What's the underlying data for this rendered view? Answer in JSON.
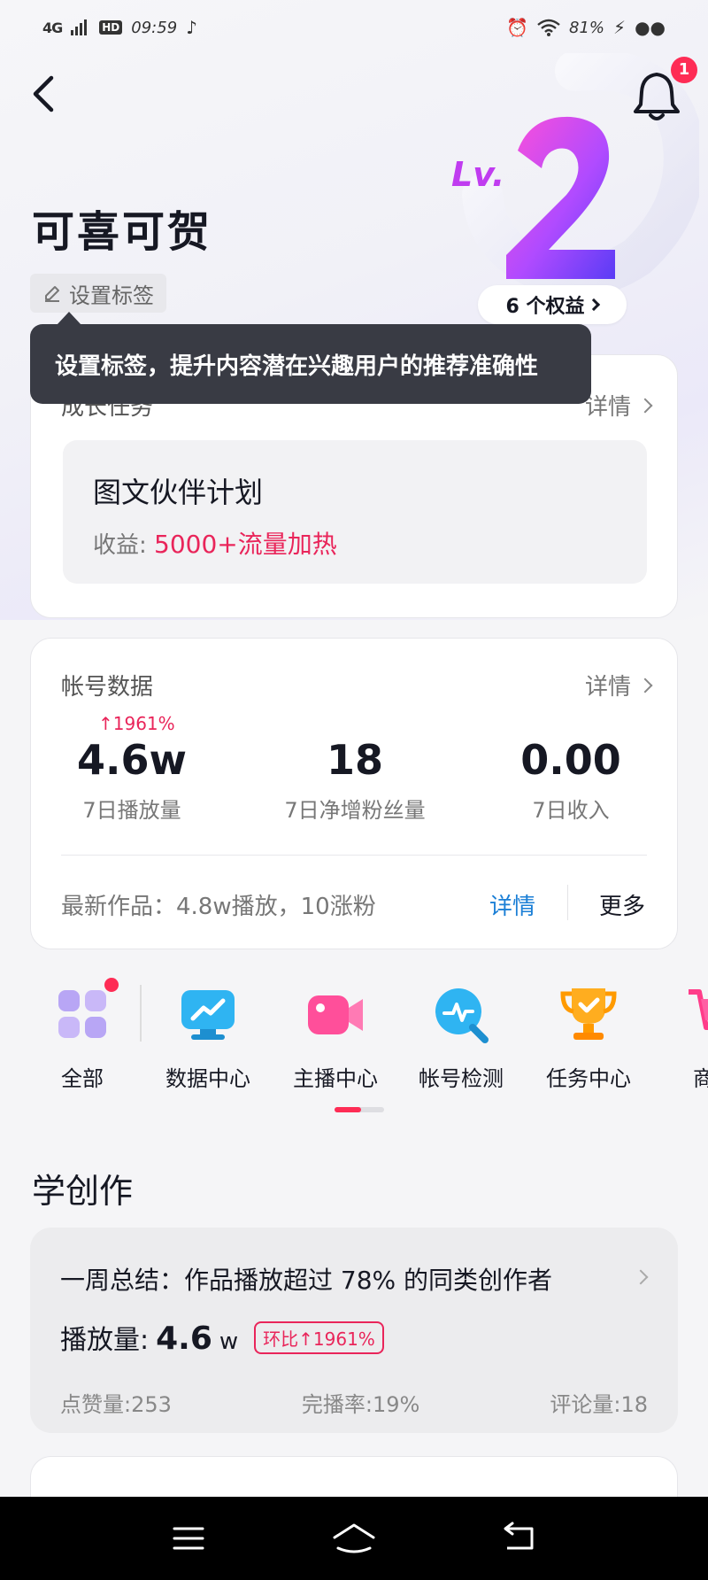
{
  "status_bar": {
    "signal": "4G",
    "hd": "HD",
    "time": "09:59",
    "battery": "81%"
  },
  "header": {
    "notification_count": "1",
    "username": "可喜可贺",
    "tag_button_label": "设置标签",
    "level_text": "Lv.2",
    "level_benefits": "6 个权益"
  },
  "tooltip": {
    "text": "设置标签，提升内容潜在兴趣用户的推荐准确性"
  },
  "growth_task": {
    "title": "成长任务",
    "detail_label": "详情",
    "plan_title": "图文伙伴计划",
    "income_label": "收益:",
    "income_value": "5000+流量加热"
  },
  "account_data": {
    "title": "帐号数据",
    "detail_label": "详情",
    "growth_tag": "↑1961%",
    "stats": [
      {
        "value": "4.6w",
        "label": "7日播放量"
      },
      {
        "value": "18",
        "label": "7日净增粉丝量"
      },
      {
        "value": "0.00",
        "label": "7日收入"
      }
    ],
    "latest_text": "最新作品：4.8w播放，10涨粉",
    "latest_detail": "详情",
    "latest_more": "更多"
  },
  "shortcuts": [
    {
      "label": "全部",
      "icon": "grid-icon"
    },
    {
      "label": "数据中心",
      "icon": "data-center-icon"
    },
    {
      "label": "主播中心",
      "icon": "live-camera-icon"
    },
    {
      "label": "帐号检测",
      "icon": "account-check-icon"
    },
    {
      "label": "任务中心",
      "icon": "trophy-icon"
    },
    {
      "label": "商品",
      "icon": "cart-icon"
    }
  ],
  "learn": {
    "section_title": "学创作",
    "summary": "一周总结：作品播放超过 78% 的同类创作者",
    "play_label": "播放量:",
    "play_value": "4.6",
    "play_unit": "w",
    "badge": "环比↑1961%",
    "metrics": [
      "点赞量:253",
      "完播率:19%",
      "评论量:18"
    ]
  },
  "colors": {
    "accent": "#fe2c55",
    "link": "#1b7fd6",
    "tooltip_bg": "#393b44"
  }
}
